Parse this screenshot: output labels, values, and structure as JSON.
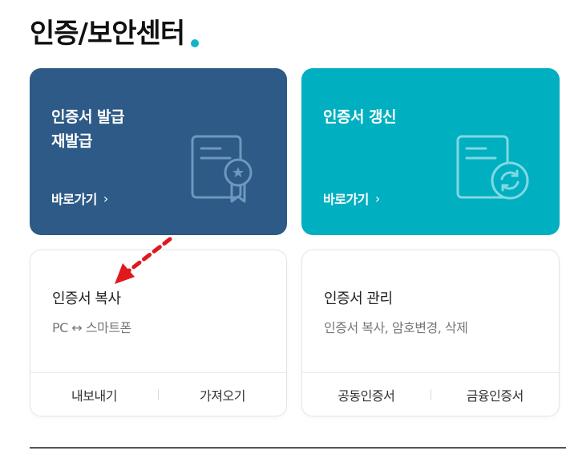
{
  "page": {
    "title": "인증/보안센터"
  },
  "cards": {
    "issue": {
      "line1": "인증서 발급",
      "line2": "재발급",
      "link": "바로가기",
      "icon": "certificate-award-icon",
      "color": "#2d5a86"
    },
    "renew": {
      "line1": "인증서 갱신",
      "link": "바로가기",
      "icon": "certificate-renew-icon",
      "color": "#00afc0"
    },
    "copy": {
      "title": "인증서 복사",
      "subtitle": "PC ↔ 스마트폰",
      "actions": [
        "내보내기",
        "가져오기"
      ]
    },
    "manage": {
      "title": "인증서 관리",
      "subtitle": "인증서 복사, 암호변경, 삭제",
      "actions": [
        "공동인증서",
        "금융인증서"
      ]
    }
  },
  "colors": {
    "accent_dot": "#14b3c6",
    "annotation_arrow": "#e0191e"
  }
}
